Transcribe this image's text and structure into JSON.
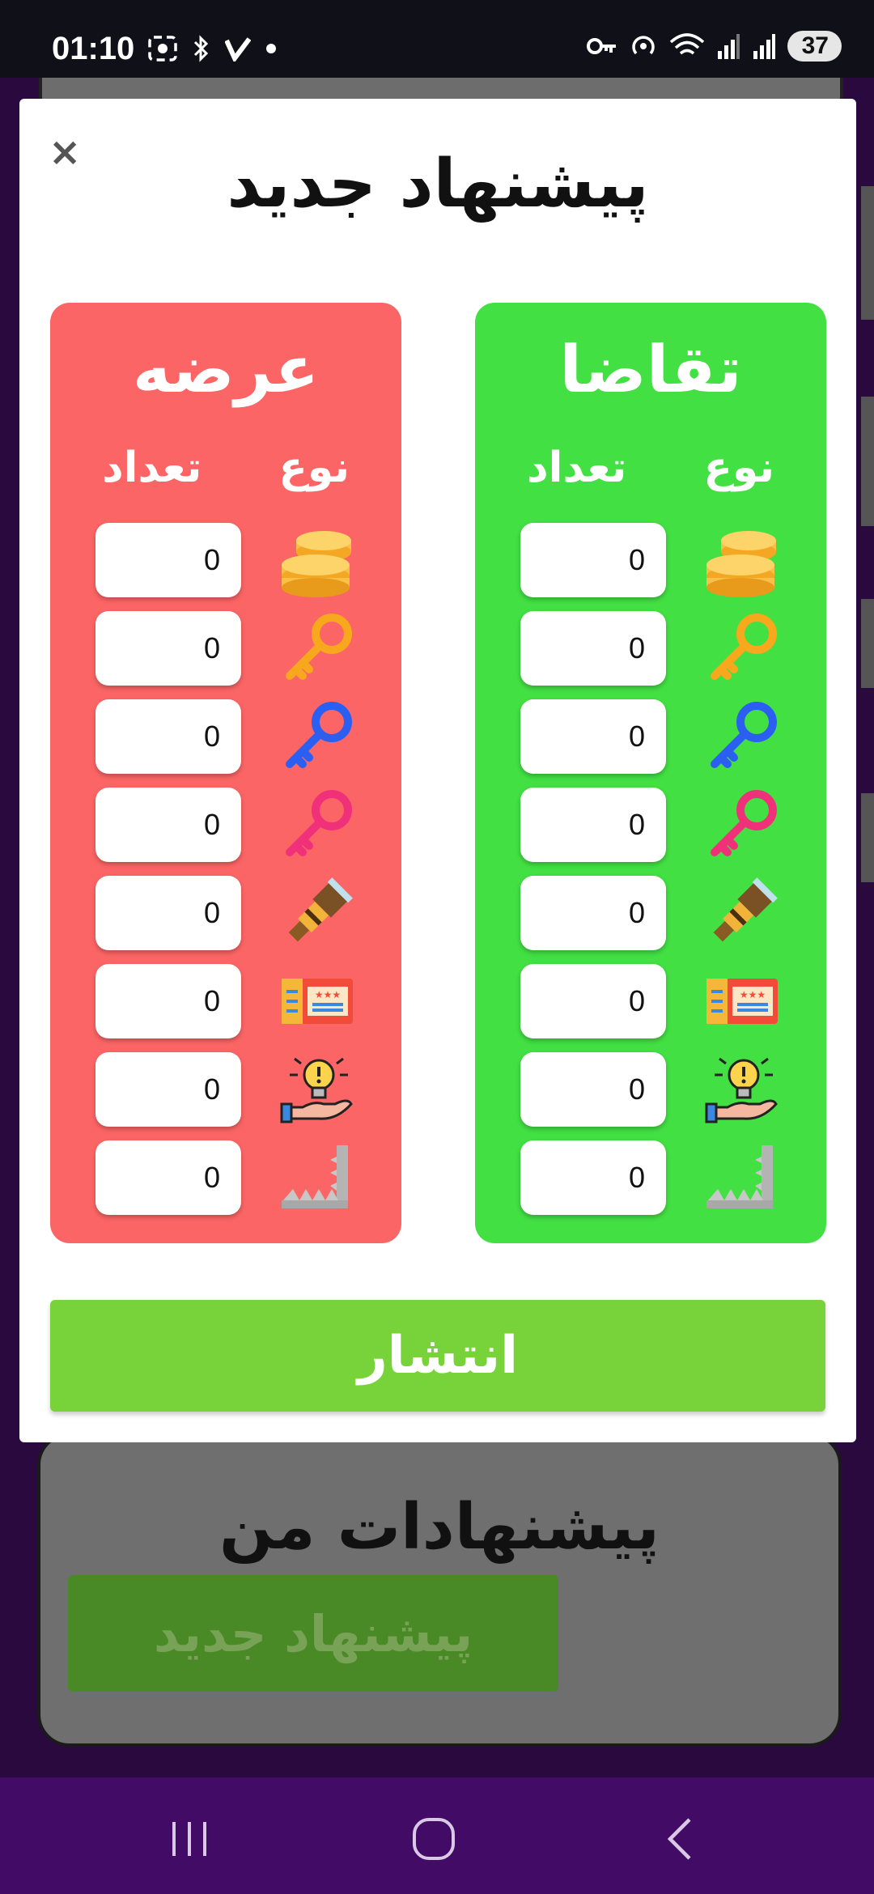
{
  "status_bar": {
    "time": "01:10",
    "battery": "37"
  },
  "background": {
    "card_title": "پیشنهادات من",
    "new_offer_button": "پیشنهاد جدید"
  },
  "modal": {
    "close_label": "×",
    "title": "پیشنهاد جدید",
    "publish_label": "انتشار"
  },
  "supply": {
    "title": "عرضه",
    "type_header": "نوع",
    "count_header": "تعداد",
    "rows": [
      {
        "icon": "coins-icon",
        "value": "0"
      },
      {
        "icon": "gold-key-icon",
        "value": "0"
      },
      {
        "icon": "blue-key-icon",
        "value": "0"
      },
      {
        "icon": "pink-key-icon",
        "value": "0"
      },
      {
        "icon": "telescope-icon",
        "value": "0"
      },
      {
        "icon": "ticket-icon",
        "value": "0"
      },
      {
        "icon": "idea-hand-icon",
        "value": "0"
      },
      {
        "icon": "trap-icon",
        "value": "0"
      }
    ]
  },
  "demand": {
    "title": "تقاضا",
    "type_header": "نوع",
    "count_header": "تعداد",
    "rows": [
      {
        "icon": "coins-icon",
        "value": "0"
      },
      {
        "icon": "gold-key-icon",
        "value": "0"
      },
      {
        "icon": "blue-key-icon",
        "value": "0"
      },
      {
        "icon": "pink-key-icon",
        "value": "0"
      },
      {
        "icon": "telescope-icon",
        "value": "0"
      },
      {
        "icon": "ticket-icon",
        "value": "0"
      },
      {
        "icon": "idea-hand-icon",
        "value": "0"
      },
      {
        "icon": "trap-icon",
        "value": "0"
      }
    ]
  },
  "colors": {
    "supply_panel": "#fc6565",
    "demand_panel": "#42e043",
    "publish_button": "#78d23a",
    "nav_bar": "#410b66"
  }
}
